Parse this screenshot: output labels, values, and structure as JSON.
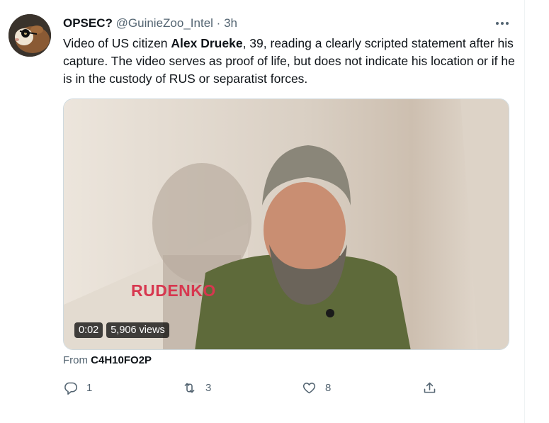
{
  "tweet": {
    "author_name": "OPSEC?",
    "author_handle": "@GuinieZoo_Intel",
    "separator": "·",
    "time": "3h",
    "text": {
      "part1": "Video of US citizen ",
      "bold_name": "Alex Drueke",
      "part2": ", 39, reading a clearly scripted statement after his capture. The video serves as proof of life, but does not indicate his location or if he is in the custody of RUS or separatist forces."
    },
    "media": {
      "watermark": "RUDENKO",
      "duration": "0:02",
      "views": "5,906 views"
    },
    "source_prefix": "From",
    "source_account": "C4H10FO2P",
    "actions": {
      "reply_count": "1",
      "retweet_count": "3",
      "like_count": "8"
    }
  },
  "icons": [
    "more-icon",
    "reply-icon",
    "retweet-icon",
    "like-icon",
    "share-icon"
  ],
  "colors": {
    "text": "#0f1419",
    "secondary": "#536471",
    "watermark": "#d7374f",
    "border": "#cfd9de"
  }
}
